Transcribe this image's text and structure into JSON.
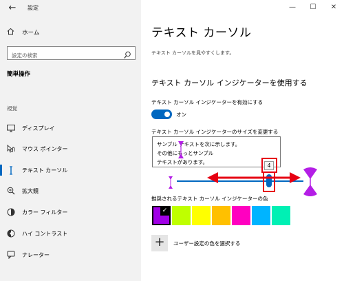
{
  "window": {
    "title": "設定",
    "controls": {
      "minimize": "—",
      "maximize": "☐",
      "close": "✕"
    }
  },
  "sidebar": {
    "home_label": "ホーム",
    "search_placeholder": "設定の検索",
    "section": "簡単操作",
    "group": "視覚",
    "items": [
      {
        "label": "ディスプレイ",
        "icon": "monitor-icon"
      },
      {
        "label": "マウス ポインター",
        "icon": "pointer-icon"
      },
      {
        "label": "テキスト カーソル",
        "icon": "text-cursor-icon",
        "active": true
      },
      {
        "label": "拡大鏡",
        "icon": "magnifier-icon"
      },
      {
        "label": "カラー フィルター",
        "icon": "color-filter-icon"
      },
      {
        "label": "ハイ コントラスト",
        "icon": "contrast-icon"
      },
      {
        "label": "ナレーター",
        "icon": "narrator-icon"
      }
    ]
  },
  "main": {
    "title": "テキスト カーソル",
    "subtitle": "テキスト カーソルを見やすくします。",
    "indicator_section": "テキスト カーソル インジケーターを使用する",
    "toggle_label": "テキスト カーソル インジケーターを有効にする",
    "toggle_state": "オン",
    "toggle_on": true,
    "size_label": "テキスト カーソル インジケーターのサイズを変更する",
    "preview_lines": [
      "サンプル テキストを次に示します。",
      "その他にもっとサンプル",
      "テキストがあります。"
    ],
    "size_value": "4",
    "size_level": 0.57,
    "color_label": "推奨されるテキスト カーソル インジケーターの色",
    "colors": [
      "#a100e6",
      "#bfff00",
      "#ffff00",
      "#ffc000",
      "#ff00c0",
      "#00b4ff",
      "#00f0b4"
    ],
    "selected_color": 0,
    "custom_color_label": "ユーザー設定の色を選択する"
  },
  "colors": {
    "accent": "#0067c0",
    "annotation": "#e60012",
    "indicator": "#b41ee6"
  }
}
